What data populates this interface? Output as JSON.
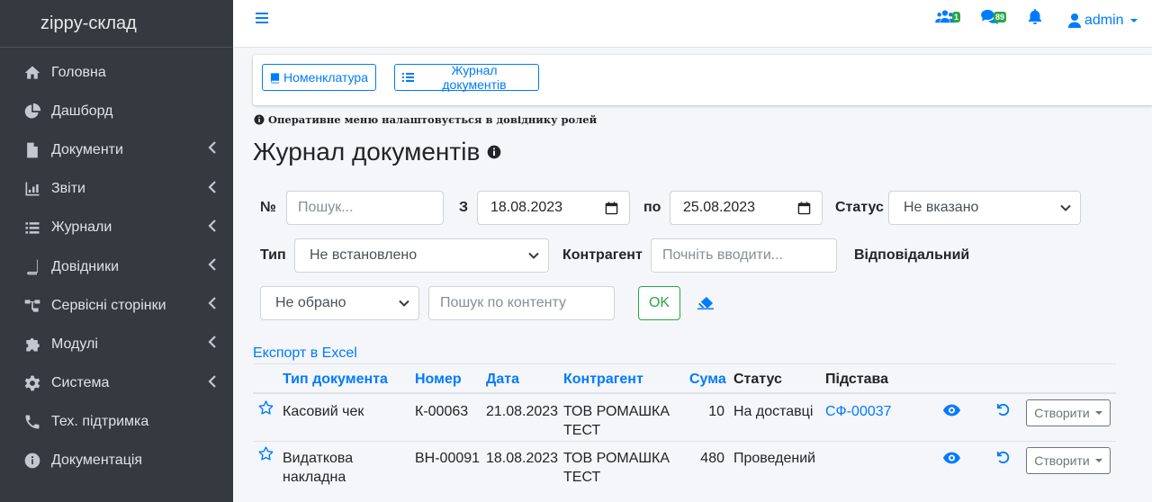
{
  "sidebar": {
    "brand": "zippy-склад",
    "items": [
      {
        "label": "Головна",
        "icon": "home-icon",
        "submenu": false
      },
      {
        "label": "Дашборд",
        "icon": "pie-chart-icon",
        "submenu": false
      },
      {
        "label": "Документи",
        "icon": "file-icon",
        "submenu": true
      },
      {
        "label": "Звіти",
        "icon": "chart-icon",
        "submenu": true
      },
      {
        "label": "Журнали",
        "icon": "list-icon",
        "submenu": true
      },
      {
        "label": "Довідники",
        "icon": "book-icon",
        "submenu": true
      },
      {
        "label": "Сервісні сторінки",
        "icon": "sitemap-icon",
        "submenu": true
      },
      {
        "label": "Модулі",
        "icon": "puzzle-icon",
        "submenu": true
      },
      {
        "label": "Система",
        "icon": "gear-icon",
        "submenu": true
      },
      {
        "label": "Тех. підтримка",
        "icon": "phone-icon",
        "submenu": false
      },
      {
        "label": "Документація",
        "icon": "info-icon",
        "submenu": false
      }
    ]
  },
  "topbar": {
    "users_badge": "1",
    "messages_badge": "89",
    "user": "admin"
  },
  "quick_menu": {
    "nomenclature": "Номенклатура",
    "journal": "Журнал документів"
  },
  "hint": "Оперативне меню налаштовується в довіднику ролей",
  "page_title": "Журнал документів",
  "filters": {
    "number_label": "№",
    "number_placeholder": "Пошук...",
    "from_label": "З",
    "from_date": "18.08.2023",
    "to_label": "по",
    "to_date": "25.08.2023",
    "status_label": "Статус",
    "status_value": "Не вказано",
    "type_label": "Тип",
    "type_value": "Не встановлено",
    "counterparty_label": "Контрагент",
    "counterparty_placeholder": "Почніть вводити...",
    "responsible_label": "Відповідальний",
    "responsible_value": "Не обрано",
    "content_placeholder": "Пошук по контенту",
    "ok_label": "OK"
  },
  "export_label": "Експорт в Excel",
  "table": {
    "headers": {
      "type": "Тип документа",
      "number": "Номер",
      "date": "Дата",
      "counterparty": "Контрагент",
      "sum": "Сума",
      "status": "Статус",
      "basis": "Підстава"
    },
    "create_label": "Створити",
    "rows": [
      {
        "type": "Касовий чек",
        "number": "К-00063",
        "date": "21.08.2023",
        "counterparty": "ТОВ РОМАШКА ТЕСТ",
        "sum": "10",
        "status": "На доставці",
        "basis": "СФ-00037"
      },
      {
        "type": "Видаткова накладна",
        "number": "ВН-00091",
        "date": "18.08.2023",
        "counterparty": "ТОВ РОМАШКА ТЕСТ",
        "sum": "480",
        "status": "Проведений",
        "basis": ""
      }
    ]
  },
  "colors": {
    "sidebar_bg": "#343a40",
    "primary": "#007bff",
    "success": "#28a745"
  }
}
